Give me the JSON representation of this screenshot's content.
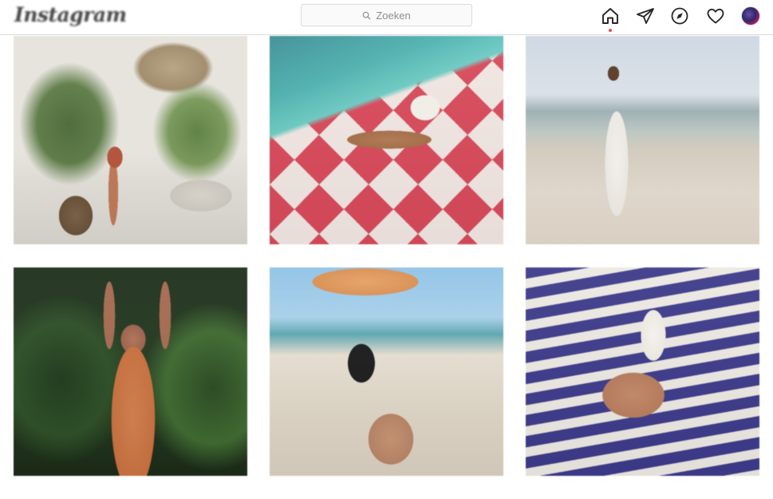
{
  "app": {
    "logo_text": "Instagram"
  },
  "search": {
    "placeholder": "Zoeken"
  },
  "nav": {
    "icons": [
      "home-icon",
      "direct-icon",
      "explore-icon",
      "activity-icon",
      "profile-avatar"
    ],
    "active": "home-icon",
    "notification_dot_color": "#ed4956"
  },
  "grid": {
    "posts": [
      {
        "id": "post-1"
      },
      {
        "id": "post-2"
      },
      {
        "id": "post-3"
      },
      {
        "id": "post-4"
      },
      {
        "id": "post-5"
      },
      {
        "id": "post-6"
      }
    ]
  },
  "colors": {
    "border": "#dbdbdb",
    "text": "#262626",
    "muted": "#8e8e8e"
  }
}
